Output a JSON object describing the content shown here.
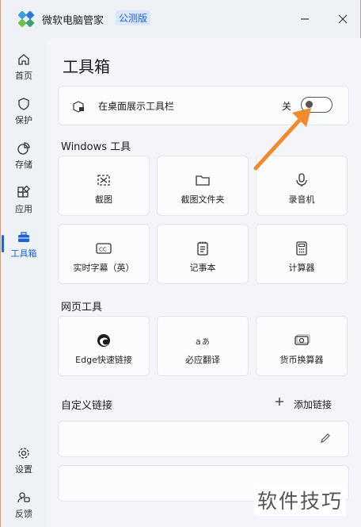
{
  "app": {
    "title": "微软电脑管家",
    "badge": "公测版"
  },
  "sidebar": {
    "items": [
      {
        "label": "首页",
        "icon": "home-icon"
      },
      {
        "label": "保护",
        "icon": "shield-icon"
      },
      {
        "label": "存储",
        "icon": "pie-chart-icon"
      },
      {
        "label": "应用",
        "icon": "apps-icon"
      },
      {
        "label": "工具箱",
        "icon": "toolbox-icon",
        "active": true
      }
    ],
    "bottom": [
      {
        "label": "设置",
        "icon": "gear-icon"
      },
      {
        "label": "反馈",
        "icon": "feedback-icon"
      }
    ]
  },
  "main": {
    "title": "工具箱",
    "desktop_toggle": {
      "label": "在桌面展示工具栏",
      "state": "关",
      "on": false
    },
    "windows_section": {
      "title": "Windows 工具",
      "tiles": [
        {
          "label": "截图",
          "icon": "screenshot-icon"
        },
        {
          "label": "截图文件夹",
          "icon": "folder-icon"
        },
        {
          "label": "录音机",
          "icon": "microphone-icon"
        },
        {
          "label": "实时字幕（英）",
          "icon": "captions-icon"
        },
        {
          "label": "记事本",
          "icon": "notepad-icon"
        },
        {
          "label": "计算器",
          "icon": "calculator-icon"
        }
      ]
    },
    "web_section": {
      "title": "网页工具",
      "tiles": [
        {
          "label": "Edge快速链接",
          "icon": "edge-icon"
        },
        {
          "label": "必应翻译",
          "icon": "translate-icon"
        },
        {
          "label": "货币换算器",
          "icon": "currency-icon"
        }
      ]
    },
    "custom_section": {
      "title": "自定义链接",
      "add_label": "添加链接"
    }
  },
  "watermark": "软件技巧",
  "colors": {
    "accent": "#1f63d8",
    "arrow": "#f08a2c",
    "background": "#eef1f6"
  }
}
